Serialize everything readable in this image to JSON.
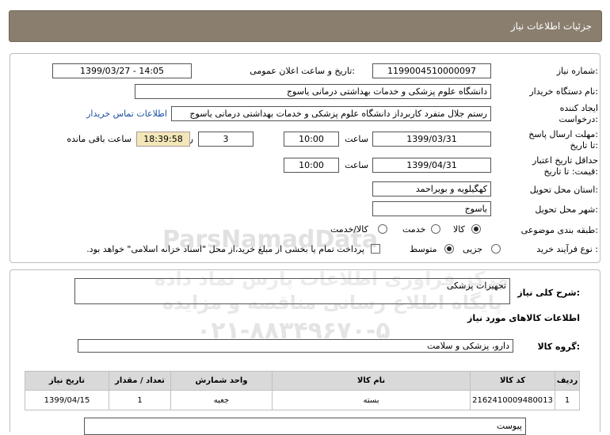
{
  "header": {
    "title": "جزئیات اطلاعات نیاز"
  },
  "need_number": {
    "label": "شماره نیاز:",
    "value": "1199004510000097"
  },
  "announce_datetime": {
    "label": "تاریخ و ساعت اعلان عمومی:",
    "value": "1399/03/27 - 14:05"
  },
  "buyer_org": {
    "label": "نام دستگاه خریدار:",
    "value": "دانشگاه علوم پزشکی و خدمات بهداشتی درمانی یاسوج"
  },
  "creator": {
    "label_line1": "ایجاد کننده",
    "label_line2": "درخواست:",
    "value": "رستم جلال متفرد کاربرداز دانشگاه علوم پزشکی و خدمات بهداشتی درمانی یاسوج",
    "contact_link": "اطلاعات تماس خریدار"
  },
  "reply_deadline": {
    "label_line1": "مهلت ارسال پاسخ:",
    "label_line2": "تا تاریخ:",
    "date": "1399/03/31",
    "time_label": "ساعت",
    "time": "10:00",
    "days": "3",
    "days_label": "روز و",
    "remaining_time": "18:39:58",
    "remaining_label": "ساعت باقی مانده"
  },
  "price_validity": {
    "label_line1": "حداقل تاریخ اعتبار",
    "label_line2": "قیمت: تا تاریخ:",
    "date": "1399/04/31",
    "time_label": "ساعت",
    "time": "10:00"
  },
  "delivery_province": {
    "label": "استان محل تحویل:",
    "value": "کهگیلویه و بویراحمد"
  },
  "delivery_city": {
    "label": "شهر محل تحویل:",
    "value": "یاسوج"
  },
  "category": {
    "label": "طبقه بندی موضوعی:",
    "options": [
      "کالا",
      "خدمت",
      "کالا/خدمت"
    ],
    "selected": "کالا"
  },
  "purchase_process": {
    "label": "نوع فرآیند خرید :",
    "options": [
      "جزیی",
      "متوسط"
    ],
    "selected": "متوسط",
    "payment_note": "پرداخت تمام یا بخشی از مبلغ خرید،از محل \"اسناد خزانه اسلامی\" خواهد بود."
  },
  "need_summary": {
    "label": "شرح کلی نیاز:",
    "value": "تجهیزات پزشکی"
  },
  "goods_info": {
    "title": "اطلاعات کالاهای مورد نیاز"
  },
  "goods_group": {
    "label": "گروه کالا:",
    "value": "دارو، پزشکی و سلامت"
  },
  "table": {
    "headers": [
      "ردیف",
      "کد کالا",
      "نام کالا",
      "واحد شمارش",
      "تعداد / مقدار",
      "تاریخ نیاز"
    ],
    "rows": [
      [
        "1",
        "2162410009480013",
        "بسته",
        "جعبه",
        "1",
        "1399/04/15"
      ]
    ]
  },
  "attachment_note": {
    "value": "پیوست"
  },
  "watermark": {
    "brand": "ParsNamadData",
    "line1": "مرکز فراوری اطلاعات پارس نماد داده",
    "line2": "پایگاه اطلاع رسانی مناقصه و مزایده",
    "phone": "۰۲۱-۸۸۳۴۹۶۷۰-۵"
  }
}
